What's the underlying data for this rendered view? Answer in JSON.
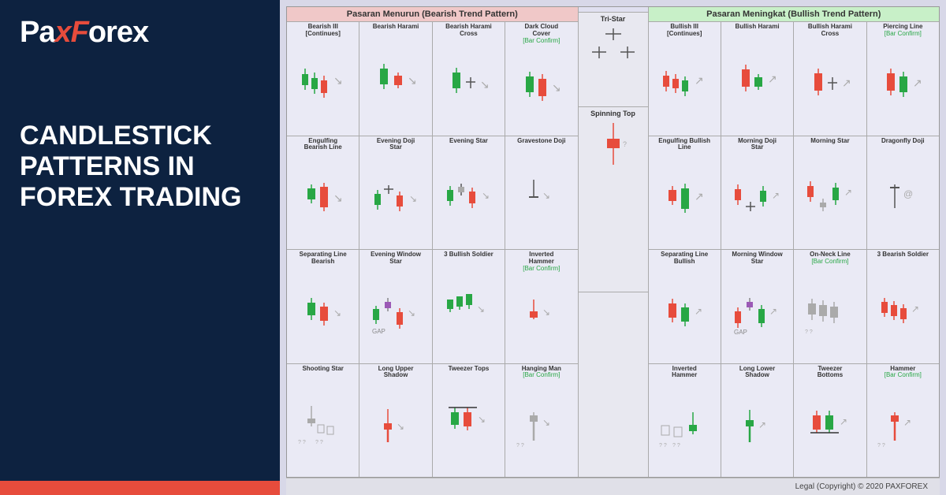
{
  "left": {
    "logo_pax": "Pax",
    "logo_forex": "Forex",
    "title_line1": "CANDLESTICK",
    "title_line2": "PATTERNS IN",
    "title_line3": "FOREX TRADING"
  },
  "bearish_header": "Pasaran Menurun (Bearish Trend Pattern)",
  "bullish_header": "Pasaran Meningkat (Bullish Trend Pattern)",
  "footer": "Legal (Copyright) © 2020 PAXFOREX",
  "bearish_rows": [
    [
      {
        "label": "Bearish III [Continues]"
      },
      {
        "label": "Bearish Harami"
      },
      {
        "label": "Bearish Harami Cross"
      },
      {
        "label": "Dark Cloud Cover",
        "sub": "[Bar Confirm]"
      }
    ],
    [
      {
        "label": "Engulfing Bearish Line"
      },
      {
        "label": "Evening Doji Star"
      },
      {
        "label": "Evening Star"
      },
      {
        "label": "Gravestone Doji"
      }
    ],
    [
      {
        "label": "Separating Line Bearish"
      },
      {
        "label": "Evening Window Star"
      },
      {
        "label": "3 Bullish Soldier"
      },
      {
        "label": "Inverted Hammer",
        "sub": "[Bar Confirm]"
      }
    ],
    [
      {
        "label": "Shooting Star"
      },
      {
        "label": "Long Upper Shadow"
      },
      {
        "label": "Tweezer Tops"
      },
      {
        "label": "Hanging Man",
        "sub": "[Bar Confirm]"
      }
    ]
  ],
  "center_rows": [
    {
      "label": "Tri-Star"
    },
    {
      "label": "Spinning Top"
    }
  ],
  "bullish_rows": [
    [
      {
        "label": "Bullish III [Continues]"
      },
      {
        "label": "Bullish Harami"
      },
      {
        "label": "Bullish Harami Cross"
      },
      {
        "label": "Piercing Line",
        "sub": "[Bar Confirm]"
      }
    ],
    [
      {
        "label": "Engulfing Bullish Line"
      },
      {
        "label": "Morning Doji Star"
      },
      {
        "label": "Morning Star"
      },
      {
        "label": "Dragonfly Doji"
      }
    ],
    [
      {
        "label": "Separating Line Bullish"
      },
      {
        "label": "Morning Window Star"
      },
      {
        "label": "On-Neck Line",
        "sub": "[Bar Confirm]"
      },
      {
        "label": "3 Bearish Soldier"
      }
    ],
    [
      {
        "label": "Inverted Hammer"
      },
      {
        "label": "Long Lower Shadow"
      },
      {
        "label": "Tweezer Bottoms"
      },
      {
        "label": "Hammer",
        "sub": "[Bar Confirm]"
      }
    ]
  ]
}
